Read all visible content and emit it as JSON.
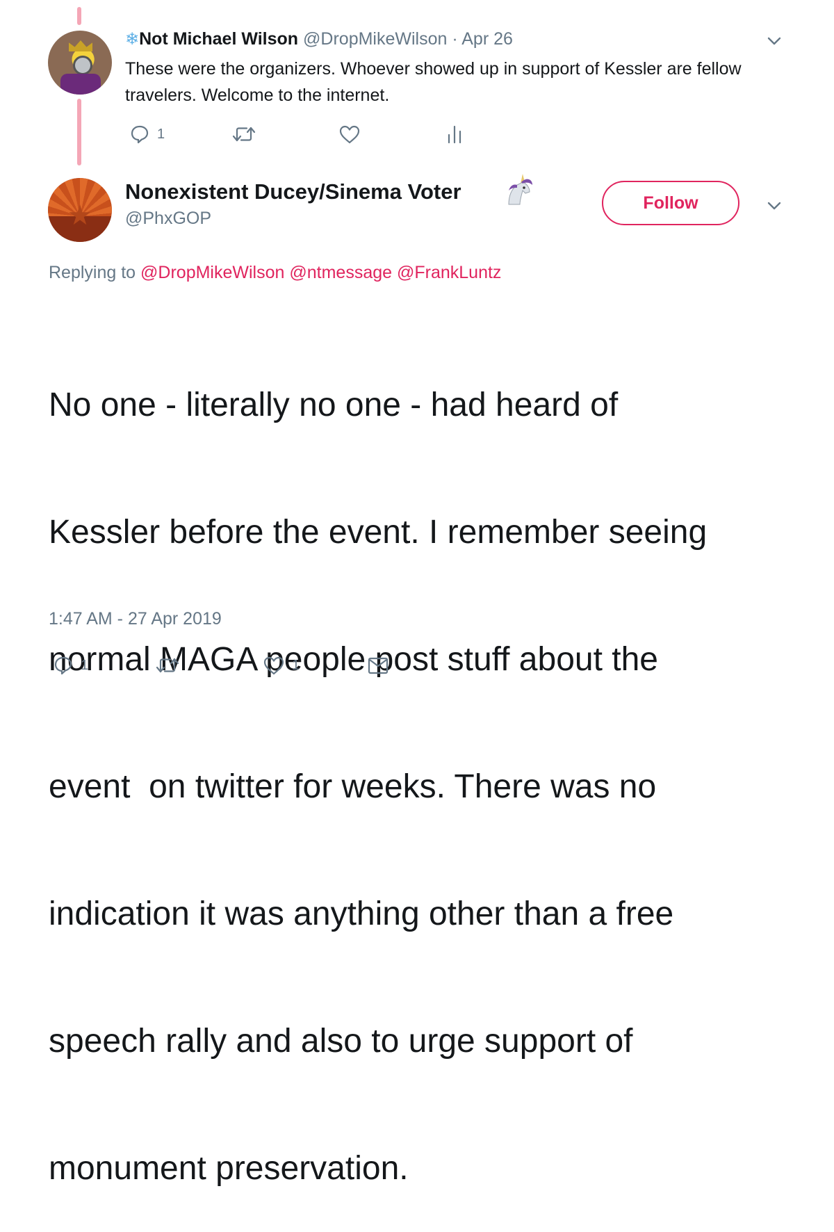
{
  "tweet1": {
    "snowflake_icon": "snowflake-icon",
    "name": "Not Michael Wilson",
    "handle": "@DropMikeWilson",
    "separator": " · ",
    "date": "Apr 26",
    "text": "These were the organizers. Whoever showed up in support of Kessler are fellow travelers. Welcome to the internet.",
    "reply_count": "1"
  },
  "tweet2": {
    "name": "Nonexistent Ducey/Sinema Voter",
    "emoji": "unicorn-emoji",
    "handle": "@PhxGOP",
    "follow_label": "Follow",
    "replying_prefix": "Replying to",
    "mentions": [
      "@DropMikeWilson",
      "@ntmessage",
      "@FrankLuntz"
    ],
    "lines": [
      "No one - literally no one - had heard of",
      "Kessler before the event. I remember seeing",
      "normal MAGA people post stuff about the",
      "event  on twitter for weeks. There was no",
      "indication it was anything other than a free",
      "speech rally and also to urge support of",
      "monument preservation."
    ],
    "timestamp": "1:47 AM - 27 Apr 2019",
    "reply_count": "1",
    "like_count": "1"
  },
  "colors": {
    "accent": "#e0245e",
    "muted": "#657786",
    "thread_line": "#f4a6b6"
  }
}
